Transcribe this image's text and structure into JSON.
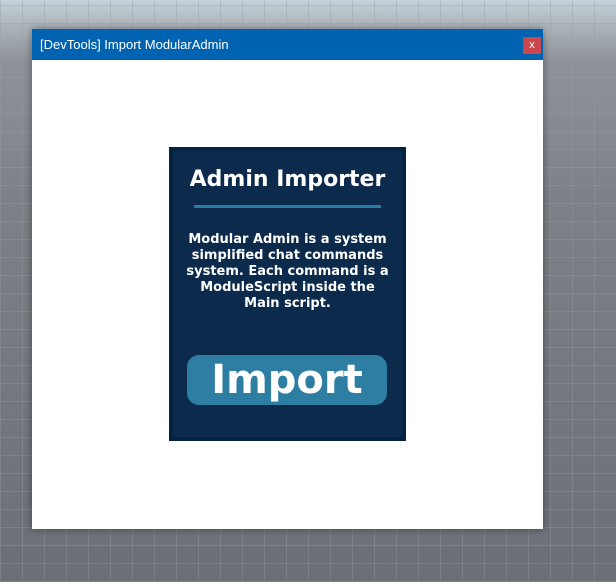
{
  "window": {
    "title": "[DevTools] Import ModularAdmin",
    "close_label": "x"
  },
  "panel": {
    "heading": "Admin Importer",
    "description": "Modular Admin is a system simplified chat commands system. Each command is a ModuleScript inside the Main script.",
    "import_label": "Import"
  },
  "colors": {
    "titlebar": "#0063b1",
    "close": "#c9474d",
    "panel": "#0b2a4c",
    "button": "#2e7ea3"
  }
}
